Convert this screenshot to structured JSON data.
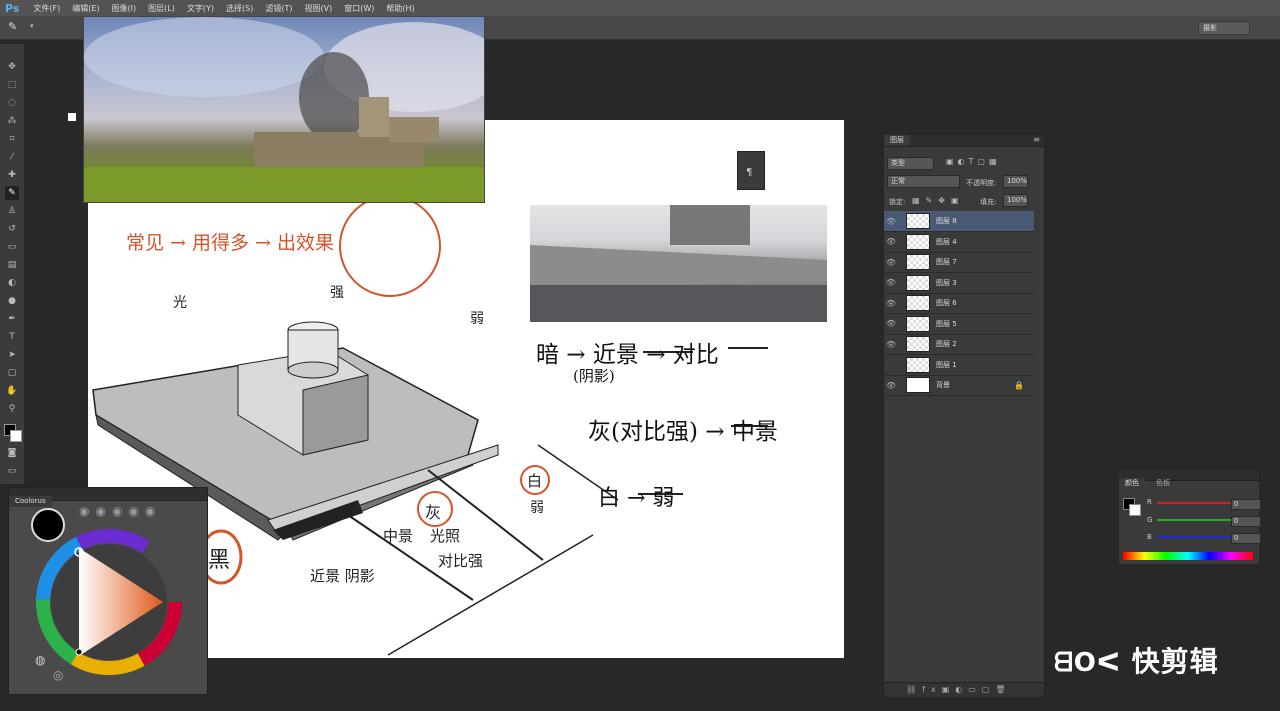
{
  "app": {
    "logo": "Ps"
  },
  "menu": [
    "文件(F)",
    "编辑(E)",
    "图像(I)",
    "图层(L)",
    "文字(Y)",
    "选择(S)",
    "滤镜(T)",
    "视图(V)",
    "窗口(W)",
    "帮助(H)"
  ],
  "options_bar": {
    "workspace": "摄影"
  },
  "annotations": {
    "red_top": "常见 → 用得多 → 出效果",
    "left_arrow_label": "光",
    "mid_arrow_label": "强",
    "right_arrow_label": "弱",
    "black": "黑",
    "near_shadow": "近景 阴影",
    "mid": "中景",
    "light": "光照",
    "contrast_strong": "对比强",
    "gray": "灰",
    "white": "白",
    "weak": "弱",
    "dark_line": "暗 → 近景 → 对比",
    "shadow_note": "(阴影)",
    "gray_line": "灰(对比强) → 中景",
    "white_line": "白 → 弱"
  },
  "layers_panel": {
    "tab": "图层",
    "filter_kind": "类型",
    "blend_mode": "正常",
    "opacity_label": "不透明度:",
    "opacity_value": "100%",
    "lock_label": "锁定:",
    "fill_label": "填充:",
    "fill_value": "100%",
    "layers": [
      {
        "name": "图层 8",
        "selected": true,
        "visible": true,
        "thumb": "transparent"
      },
      {
        "name": "图层 4",
        "selected": false,
        "visible": true,
        "thumb": "transparent"
      },
      {
        "name": "图层 7",
        "selected": false,
        "visible": true,
        "thumb": "transparent"
      },
      {
        "name": "图层 3",
        "selected": false,
        "visible": true,
        "thumb": "transparent"
      },
      {
        "name": "图层 6",
        "selected": false,
        "visible": true,
        "thumb": "transparent"
      },
      {
        "name": "图层 5",
        "selected": false,
        "visible": true,
        "thumb": "transparent"
      },
      {
        "name": "图层 2",
        "selected": false,
        "visible": true,
        "thumb": "transparent"
      },
      {
        "name": "图层 1",
        "selected": false,
        "visible": false,
        "thumb": "transparent"
      },
      {
        "name": "背景",
        "selected": false,
        "visible": true,
        "thumb": "white",
        "locked": true
      }
    ]
  },
  "color_panel": {
    "tabs": [
      "颜色",
      "色板"
    ],
    "r_label": "R",
    "g_label": "G",
    "b_label": "B",
    "r_value": "0",
    "g_value": "0",
    "b_value": "0",
    "colors": {
      "r": "#d02020",
      "g": "#20b020",
      "b": "#2030d0"
    }
  },
  "coolorus": {
    "title": "Coolorus"
  },
  "watermark": "快剪辑"
}
